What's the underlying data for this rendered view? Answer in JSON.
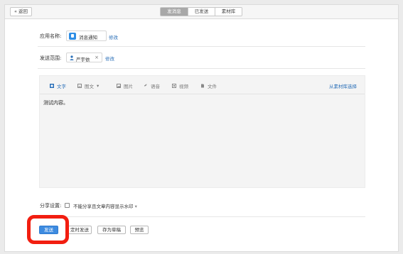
{
  "topbar": {
    "back_label": "« 返回",
    "tabs": [
      {
        "label": "发消息",
        "active": true
      },
      {
        "label": "已发送",
        "active": false
      },
      {
        "label": "素材库",
        "active": false
      }
    ]
  },
  "form": {
    "app_label": "应用名称:",
    "app_name": "消息通知",
    "app_edit": "修改",
    "scope_label": "发送范围:",
    "scope_user": "严宇依",
    "scope_edit": "修改"
  },
  "editor": {
    "tools": [
      {
        "label": "文字",
        "icon": "text-icon",
        "active": true
      },
      {
        "label": "图文",
        "icon": "article-icon",
        "active": false
      },
      {
        "label": "图片",
        "icon": "image-icon",
        "active": false
      },
      {
        "label": "语音",
        "icon": "voice-icon",
        "active": false
      },
      {
        "label": "视频",
        "icon": "video-icon",
        "active": false
      },
      {
        "label": "文件",
        "icon": "file-icon",
        "active": false
      }
    ],
    "from_library": "从素材库选择",
    "content": "测试内容。"
  },
  "share": {
    "label": "分享设置:",
    "option": "不能分享且文章内容显示水印",
    "checked": false
  },
  "actions": {
    "send": "发送",
    "schedule": "定时发送",
    "draft": "存为草稿",
    "preview": "预览"
  },
  "colors": {
    "accent": "#3d8be0",
    "link": "#2a6fb8",
    "highlight": "#f21e10"
  }
}
